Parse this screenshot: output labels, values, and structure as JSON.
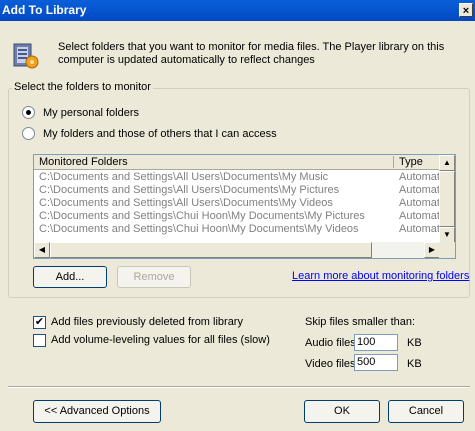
{
  "window": {
    "title": "Add To Library",
    "close_glyph": "×"
  },
  "intro": {
    "icon": "library-icon",
    "text": "Select folders that you want to monitor for media files. The Player library on this computer is updated automatically to reflect changes"
  },
  "group": {
    "label": "Select the folders to monitor",
    "options": [
      {
        "label": "My personal folders",
        "selected": true
      },
      {
        "label": "My folders and those of others that I can access",
        "selected": false
      }
    ]
  },
  "folders_list": {
    "headers": [
      "Monitored Folders",
      "Type"
    ],
    "rows": [
      {
        "path": "C:\\Documents and Settings\\All Users\\Documents\\My Music",
        "type": "Automatic"
      },
      {
        "path": "C:\\Documents and Settings\\All Users\\Documents\\My Pictures",
        "type": "Automatic"
      },
      {
        "path": "C:\\Documents and Settings\\All Users\\Documents\\My Videos",
        "type": "Automatic"
      },
      {
        "path": "C:\\Documents and Settings\\Chui Hoon\\My Documents\\My Pictures",
        "type": "Automatic"
      },
      {
        "path": "C:\\Documents and Settings\\Chui Hoon\\My Documents\\My Videos",
        "type": "Automatic"
      }
    ]
  },
  "buttons": {
    "add": "Add...",
    "remove": "Remove",
    "advanced": "<< Advanced Options",
    "ok": "OK",
    "cancel": "Cancel"
  },
  "link": "Learn more about monitoring folders",
  "options": {
    "add_deleted": {
      "label": "Add files previously deleted from library",
      "checked": true
    },
    "volume_leveling": {
      "label": "Add volume-leveling values for all files (slow)",
      "checked": false
    }
  },
  "skip": {
    "label": "Skip files smaller than:",
    "audio_label": "Audio files:",
    "audio_value": "100",
    "video_label": "Video files:",
    "video_value": "500",
    "unit": "KB"
  }
}
